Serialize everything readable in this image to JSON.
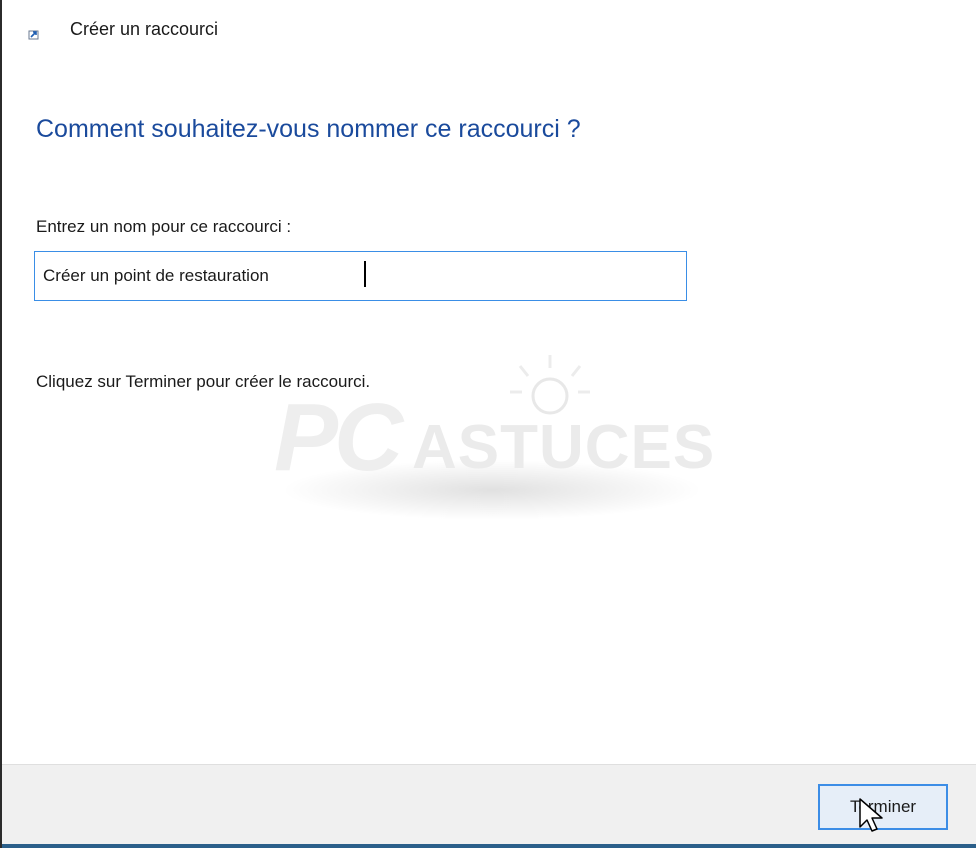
{
  "window": {
    "title": "Créer un raccourci",
    "title_icon": "shortcut-arrow-icon"
  },
  "wizard": {
    "heading": "Comment souhaitez-vous nommer ce raccourci ?",
    "name_label": "Entrez un nom pour ce raccourci :",
    "name_value": "Créer un point de restauration",
    "hint": "Cliquez sur Terminer pour créer le raccourci."
  },
  "footer": {
    "finish_label": "Terminer"
  },
  "watermark": {
    "brand_logo": "PC ASTUCES"
  },
  "colors": {
    "heading": "#1a4a9c",
    "input_border": "#3a8ee6",
    "footer_bg": "#f0f0f0",
    "button_border": "#3c8de6"
  }
}
